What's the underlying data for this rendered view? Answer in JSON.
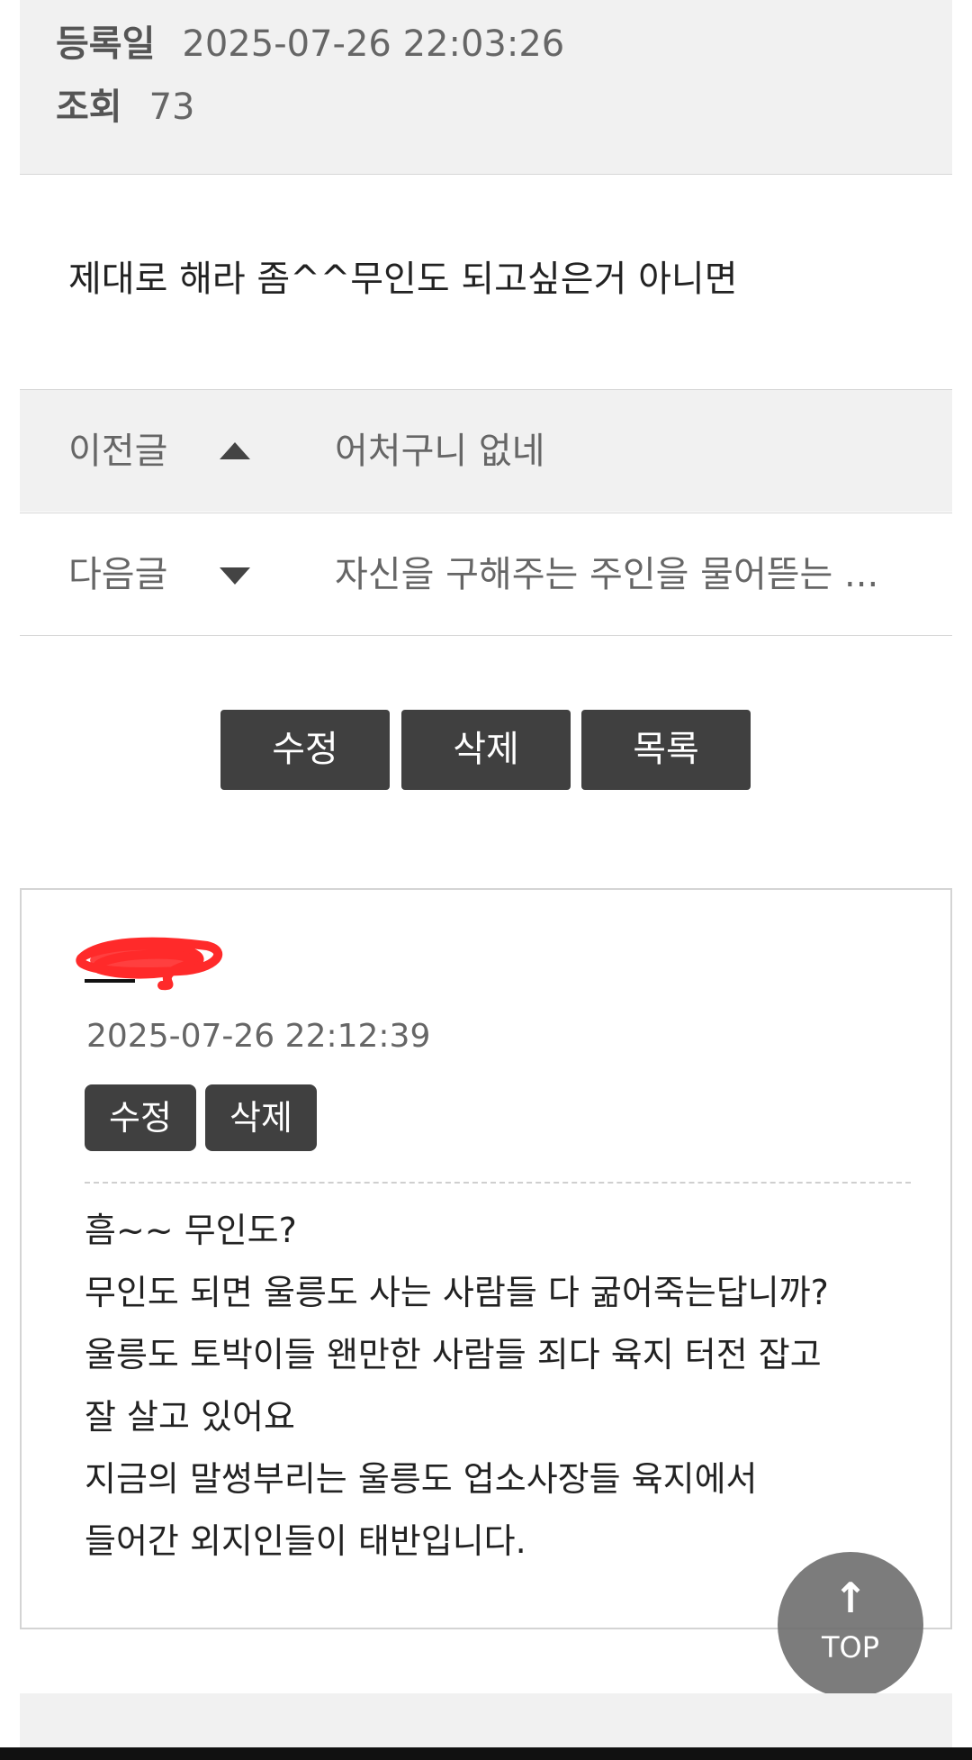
{
  "meta": {
    "date_label": "등록일",
    "date_value": "2025-07-26 22:03:26",
    "views_label": "조회",
    "views_value": "73"
  },
  "post": {
    "content": "제대로 해라 좀^^무인도 되고싶은거 아니면"
  },
  "nav": {
    "prev_label": "이전글",
    "prev_title": "어처구니 없네",
    "next_label": "다음글",
    "next_title": "자신을 구해주는 주인을 물어뜯는 ..."
  },
  "buttons": {
    "edit": "수정",
    "delete": "삭제",
    "list": "목록"
  },
  "comment": {
    "date": "2025-07-26 22:12:39",
    "edit": "수정",
    "delete": "삭제",
    "lines": [
      "흠~~ 무인도?",
      "무인도 되면 울릉도 사는 사람들 다 굶어죽는답니까?",
      "울릉도 토박이들 왠만한 사람들 죄다 육지 터전 잡고",
      "잘 살고 있어요",
      "지금의 말썽부리는 울릉도 업소사장들 육지에서",
      "들어간 외지인들이 태반입니다."
    ]
  },
  "top_button": {
    "arrow_icon": "arrow-up-icon",
    "label": "TOP"
  },
  "colors": {
    "button_bg": "#404040",
    "panel_bg": "#f1f1f1",
    "scribble": "#ff2a2a"
  }
}
